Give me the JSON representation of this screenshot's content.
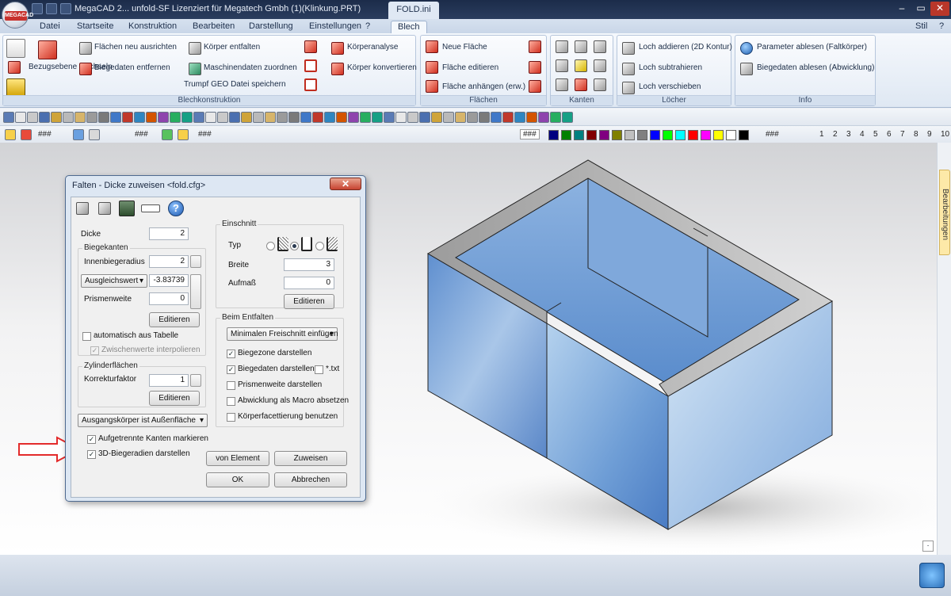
{
  "app": {
    "title": "MegaCAD 2... unfold-SF  Lizenziert für Megatech Gmbh (1)(Klinkung.PRT)",
    "context_tab": "FOLD.ini",
    "logo_text": "MEGACAD",
    "stil_label": "Stil"
  },
  "tabs": [
    "Datei",
    "Startseite",
    "Konstruktion",
    "Bearbeiten",
    "Darstellung",
    "Einstellungen",
    "?",
    "Blech"
  ],
  "ribbon": {
    "blech": {
      "label": "Blechkonstruktion",
      "bezugsebene": "Bezugsebene wechseln",
      "flaechen_neu": "Flächen neu ausrichten",
      "biegedaten_entfernen": "Biegedaten entfernen",
      "koerper_entfalten": "Körper entfalten",
      "maschinendaten": "Maschinendaten zuordnen",
      "trumpf": "Trumpf GEO Datei speichern",
      "koerperanalyse": "Körperanalyse",
      "koerper_konvertieren": "Körper konvertieren"
    },
    "flaechen": {
      "label": "Flächen",
      "neu": "Neue Fläche",
      "edit": "Fläche editieren",
      "anhaengen": "Fläche anhängen (erw.)"
    },
    "kanten": {
      "label": "Kanten"
    },
    "loecher": {
      "label": "Löcher",
      "addieren": "Loch addieren (2D Kontur)",
      "subtrahieren": "Loch subtrahieren",
      "verschieben": "Loch verschieben"
    },
    "info": {
      "label": "Info",
      "parameter": "Parameter  ablesen (Faltkörper)",
      "biegedaten": "Biegedaten ablesen (Abwicklung)"
    }
  },
  "toolbar2": {
    "hash1": "###",
    "hash2": "###",
    "hash3": "###",
    "hash4": "###",
    "hash5": "###",
    "hash6": "###",
    "layers": [
      "1",
      "2",
      "3",
      "4",
      "5",
      "6",
      "7",
      "8",
      "9",
      "10"
    ],
    "colors": [
      "#000080",
      "#008000",
      "#008080",
      "#800000",
      "#800080",
      "#808000",
      "#c0c0c0",
      "#808080",
      "#0000ff",
      "#00ff00",
      "#00ffff",
      "#ff0000",
      "#ff00ff",
      "#ffff00",
      "#ffffff",
      "#000000"
    ]
  },
  "sidebar": {
    "tab": "Bearbeitungen"
  },
  "dialog": {
    "title": "Falten - Dicke zuweisen <fold.cfg>",
    "dicke_label": "Dicke",
    "dicke_value": "2",
    "biegekanten_label": "Biegekanten",
    "innenbiegeradius_label": "Innenbiegeradius",
    "innenbiegeradius_value": "2",
    "ausgleich_select": "Ausgleichswert",
    "ausgleich_value": "-3.83739",
    "prismenweite_label": "Prismenweite",
    "prismenweite_value": "0",
    "editieren": "Editieren",
    "auto_tabelle": "automatisch aus Tabelle",
    "zwischenwerte": "Zwischenwerte interpolieren",
    "zylinder_label": "Zylinderflächen",
    "korrektur_label": "Korrekturfaktor",
    "korrektur_value": "1",
    "ausgang_select": "Ausgangskörper ist Außenfläche",
    "aufgetrennt": "Aufgetrennte Kanten markieren",
    "biegeradien3d": "3D-Biegeradien darstellen",
    "einschnitt_label": "Einschnitt",
    "typ_label": "Typ",
    "breite_label": "Breite",
    "breite_value": "3",
    "aufmass_label": "Aufmaß",
    "aufmass_value": "0",
    "beim_entfalten_label": "Beim Entfalten",
    "freischnitt_select": "Minimalen Freischnitt einfügen",
    "biegezone": "Biegezone darstellen",
    "biegedaten": "Biegedaten darstellen",
    "txt": "*.txt",
    "prismenweite_darstellen": "Prismenweite  darstellen",
    "abwicklung_macro": "Abwicklung als Macro absetzen",
    "facettierung": "Körperfacettierung benutzen",
    "von_element": "von Element",
    "zuweisen": "Zuweisen",
    "ok": "OK",
    "abbrechen": "Abbrechen"
  }
}
